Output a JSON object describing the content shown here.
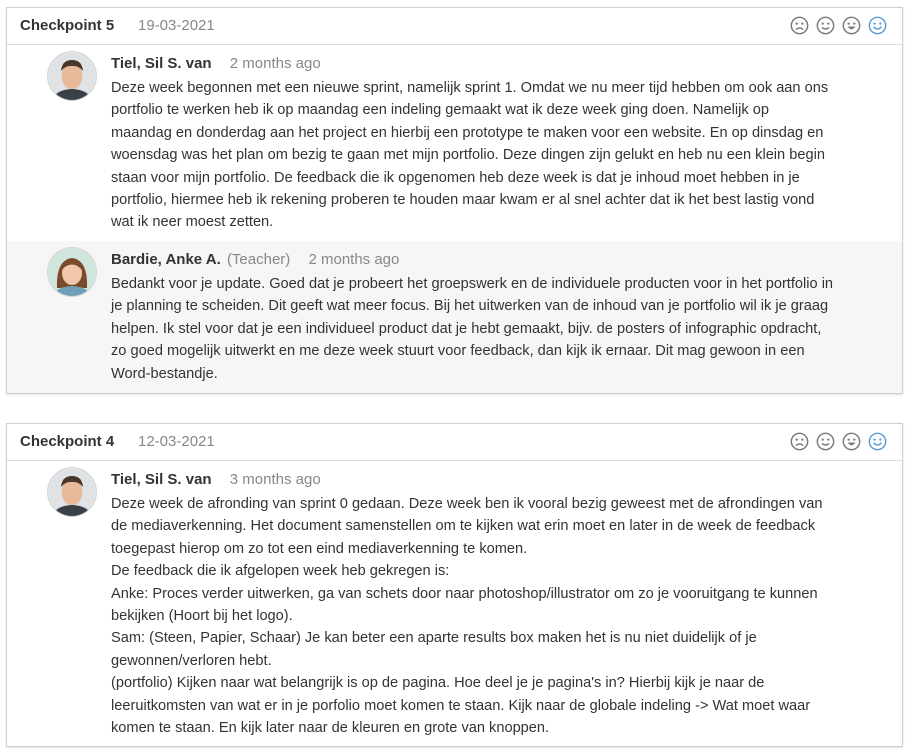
{
  "colors": {
    "border": "#cfcfcf",
    "muted": "#888888",
    "text": "#333333",
    "teacher_bg": "#f6f6f6",
    "mood_selected": "#5b9bd5",
    "mood_default": "#777777"
  },
  "mood_icons": [
    "sad-face-icon",
    "neutral-face-icon",
    "grin-face-icon",
    "happy-face-icon"
  ],
  "checkpoints": [
    {
      "title": "Checkpoint 5",
      "date": "19-03-2021",
      "selected_mood": "happy",
      "entries": [
        {
          "author": "Tiel, Sil S. van",
          "role": "",
          "time": "2 months ago",
          "avatar": "student-avatar",
          "lines": [
            "Deze week begonnen met een nieuwe sprint, namelijk sprint 1. Omdat we nu meer tijd hebben om ook aan ons",
            "portfolio te werken heb ik op maandag een indeling gemaakt wat ik deze week ging doen. Namelijk op",
            "maandag en donderdag aan het project en hierbij een prototype te maken voor een website. En op dinsdag  en",
            "woensdag was het plan om bezig te gaan met mijn portfolio. Deze dingen zijn gelukt en heb nu een klein begin",
            "staan voor mijn portfolio. De feedback die ik opgenomen heb deze week is dat je inhoud moet hebben in je",
            "portfolio, hiermee heb ik rekening proberen te houden maar kwam er al snel achter dat ik het best lastig vond",
            "wat ik neer moest zetten."
          ]
        },
        {
          "author": "Bardie, Anke A.",
          "role": "(Teacher)",
          "time": "2 months ago",
          "avatar": "teacher-avatar",
          "lines": [
            "Bedankt voor je update. Goed dat je probeert het groepswerk en de individuele producten voor in het portfolio in",
            "je planning te scheiden. Dit geeft wat meer focus. Bij het uitwerken van de inhoud van je portfolio wil ik je graag",
            "helpen. Ik stel voor dat je een individueel product dat je hebt gemaakt, bijv. de posters of infographic opdracht,",
            "zo goed mogelijk uitwerkt en me deze week stuurt voor feedback, dan kijk ik ernaar. Dit mag gewoon in een",
            "Word-bestandje."
          ]
        }
      ]
    },
    {
      "title": "Checkpoint 4",
      "date": "12-03-2021",
      "selected_mood": "happy",
      "entries": [
        {
          "author": "Tiel, Sil S. van",
          "role": "",
          "time": "3 months ago",
          "avatar": "student-avatar",
          "lines": [
            "Deze week de afronding van sprint 0 gedaan. Deze week ben ik vooral bezig geweest met de afrondingen van",
            "de mediaverkenning. Het document samenstellen om te kijken wat erin moet en later in de week de feedback",
            "toegepast hierop om zo tot een eind mediaverkenning te komen.",
            "De feedback die ik afgelopen week heb gekregen is:",
            "Anke: Proces verder uitwerken, ga van schets door naar photoshop/illustrator om zo je vooruitgang te kunnen",
            "bekijken (Hoort bij het logo).",
            "Sam: (Steen, Papier, Schaar) Je kan beter een aparte results box maken het is nu niet duidelijk of je",
            "gewonnen/verloren hebt.",
            "(portfolio) Kijken naar wat belangrijk is op de pagina. Hoe deel je je pagina's in? Hierbij kijk je naar de",
            "leeruitkomsten van wat er in je porfolio moet komen te staan. Kijk naar de globale indeling -> Wat moet waar",
            "komen te staan. En kijk later naar de kleuren en grote van knoppen."
          ]
        }
      ]
    }
  ]
}
